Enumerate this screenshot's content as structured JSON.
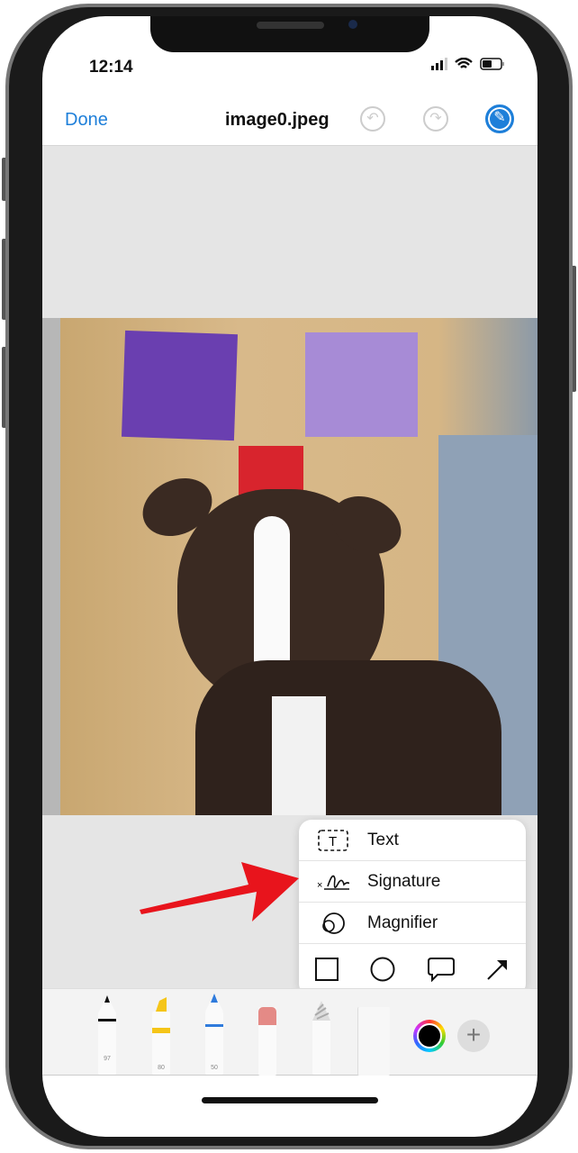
{
  "status": {
    "time": "12:14"
  },
  "nav": {
    "done": "Done",
    "title": "image0.jpeg",
    "undo_icon": "undo-icon",
    "redo_icon": "redo-icon",
    "markup_icon": "markup-pen-icon"
  },
  "menu": {
    "items": [
      {
        "label": "Text",
        "icon": "text-box-icon"
      },
      {
        "label": "Signature",
        "icon": "signature-icon"
      },
      {
        "label": "Magnifier",
        "icon": "magnifier-icon"
      }
    ],
    "shapes": [
      "square-icon",
      "circle-icon",
      "speech-bubble-icon",
      "arrow-icon"
    ]
  },
  "toolbar": {
    "tools": [
      {
        "name": "pen",
        "value": "97",
        "color": "#111111"
      },
      {
        "name": "highlighter",
        "value": "80",
        "color": "#f5c518"
      },
      {
        "name": "pencil",
        "value": "50",
        "color": "#2f7bdc"
      },
      {
        "name": "eraser",
        "color": "#e48a86"
      },
      {
        "name": "lasso"
      },
      {
        "name": "ruler"
      }
    ],
    "color_selected": "#000000"
  },
  "colors": {
    "accent": "#1e7fd9",
    "annotation_arrow": "#e8141c"
  }
}
